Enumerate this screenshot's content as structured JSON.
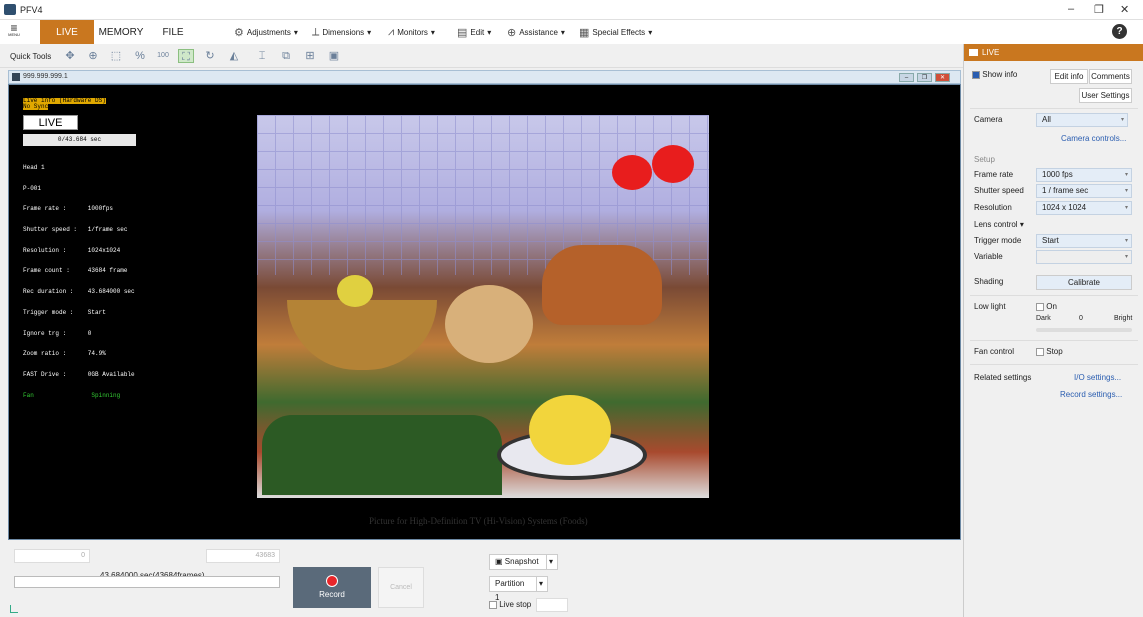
{
  "window": {
    "title": "PFV4",
    "minimize": "–",
    "restore": "❐",
    "close": "✕"
  },
  "menu": {
    "menu_label": "MENU",
    "tabs": [
      {
        "label": "LIVE"
      },
      {
        "label": "MEMORY"
      },
      {
        "label": "FILE"
      }
    ],
    "items": [
      {
        "label": "Adjustments",
        "icon": "adjustments-icon"
      },
      {
        "label": "Dimensions",
        "icon": "dimensions-icon"
      },
      {
        "label": "Monitors",
        "icon": "monitors-icon"
      },
      {
        "label": "Edit",
        "icon": "edit-icon"
      },
      {
        "label": "Assistance",
        "icon": "assistance-icon"
      },
      {
        "label": "Special Effects",
        "icon": "special-effects-icon"
      }
    ],
    "help": "?"
  },
  "quick_tools": {
    "label": "Quick Tools",
    "zoom100": "100"
  },
  "viewer": {
    "title": "999.999.999.1",
    "overlay_header": "Live info (Hardware DS)",
    "overlay_sync": "No Sync",
    "live_label": "LIVE",
    "time": "0/43.684 sec",
    "info_lines": [
      "Head 1",
      "P-001",
      "Frame rate :      1000fps",
      "Shutter speed :   1/frame sec",
      "Resolution :      1024x1024",
      "Frame count :     43684 frame",
      "Rec duration :    43.684000 sec",
      "Trigger mode :    Start",
      "Ignore trg :      0",
      "Zoom ratio :      74.9%",
      "FAST Drive :      0GB Available"
    ],
    "fan_label": "Fan",
    "fan_value": "Spinning",
    "caption": "Picture for High-Definition TV (Hi-Vision) Systems (Foods)"
  },
  "bottom": {
    "start_frame": "0",
    "end_frame": "43683",
    "range_label": "43.684000 sec(43684frames)",
    "record": "Record",
    "cancel": "Cancel",
    "snapshot": "Snapshot",
    "partition": "Partition 1",
    "live_stop": "Live stop"
  },
  "right_panel": {
    "header": "LIVE",
    "show_info": "Show info",
    "edit_info": "Edit info",
    "comments": "Comments",
    "user_settings": "User Settings",
    "camera_label": "Camera",
    "camera_value": "All",
    "camera_controls": "Camera controls...",
    "setup_label": "Setup",
    "frame_rate_label": "Frame rate",
    "frame_rate_value": "1000 fps",
    "shutter_label": "Shutter speed",
    "shutter_value": "1 / frame sec",
    "resolution_label": "Resolution",
    "resolution_value": "1024 x 1024",
    "lens_label": "Lens control",
    "trigger_label": "Trigger mode",
    "trigger_value": "Start",
    "variable_label": "Variable",
    "shading_label": "Shading",
    "calibrate": "Calibrate",
    "low_light_label": "Low light",
    "low_light_on": "On",
    "dark": "Dark",
    "low_light_value": "0",
    "bright": "Bright",
    "fan_label": "Fan control",
    "fan_stop": "Stop",
    "related_label": "Related settings",
    "io_settings": "I/O settings...",
    "record_settings": "Record settings..."
  }
}
